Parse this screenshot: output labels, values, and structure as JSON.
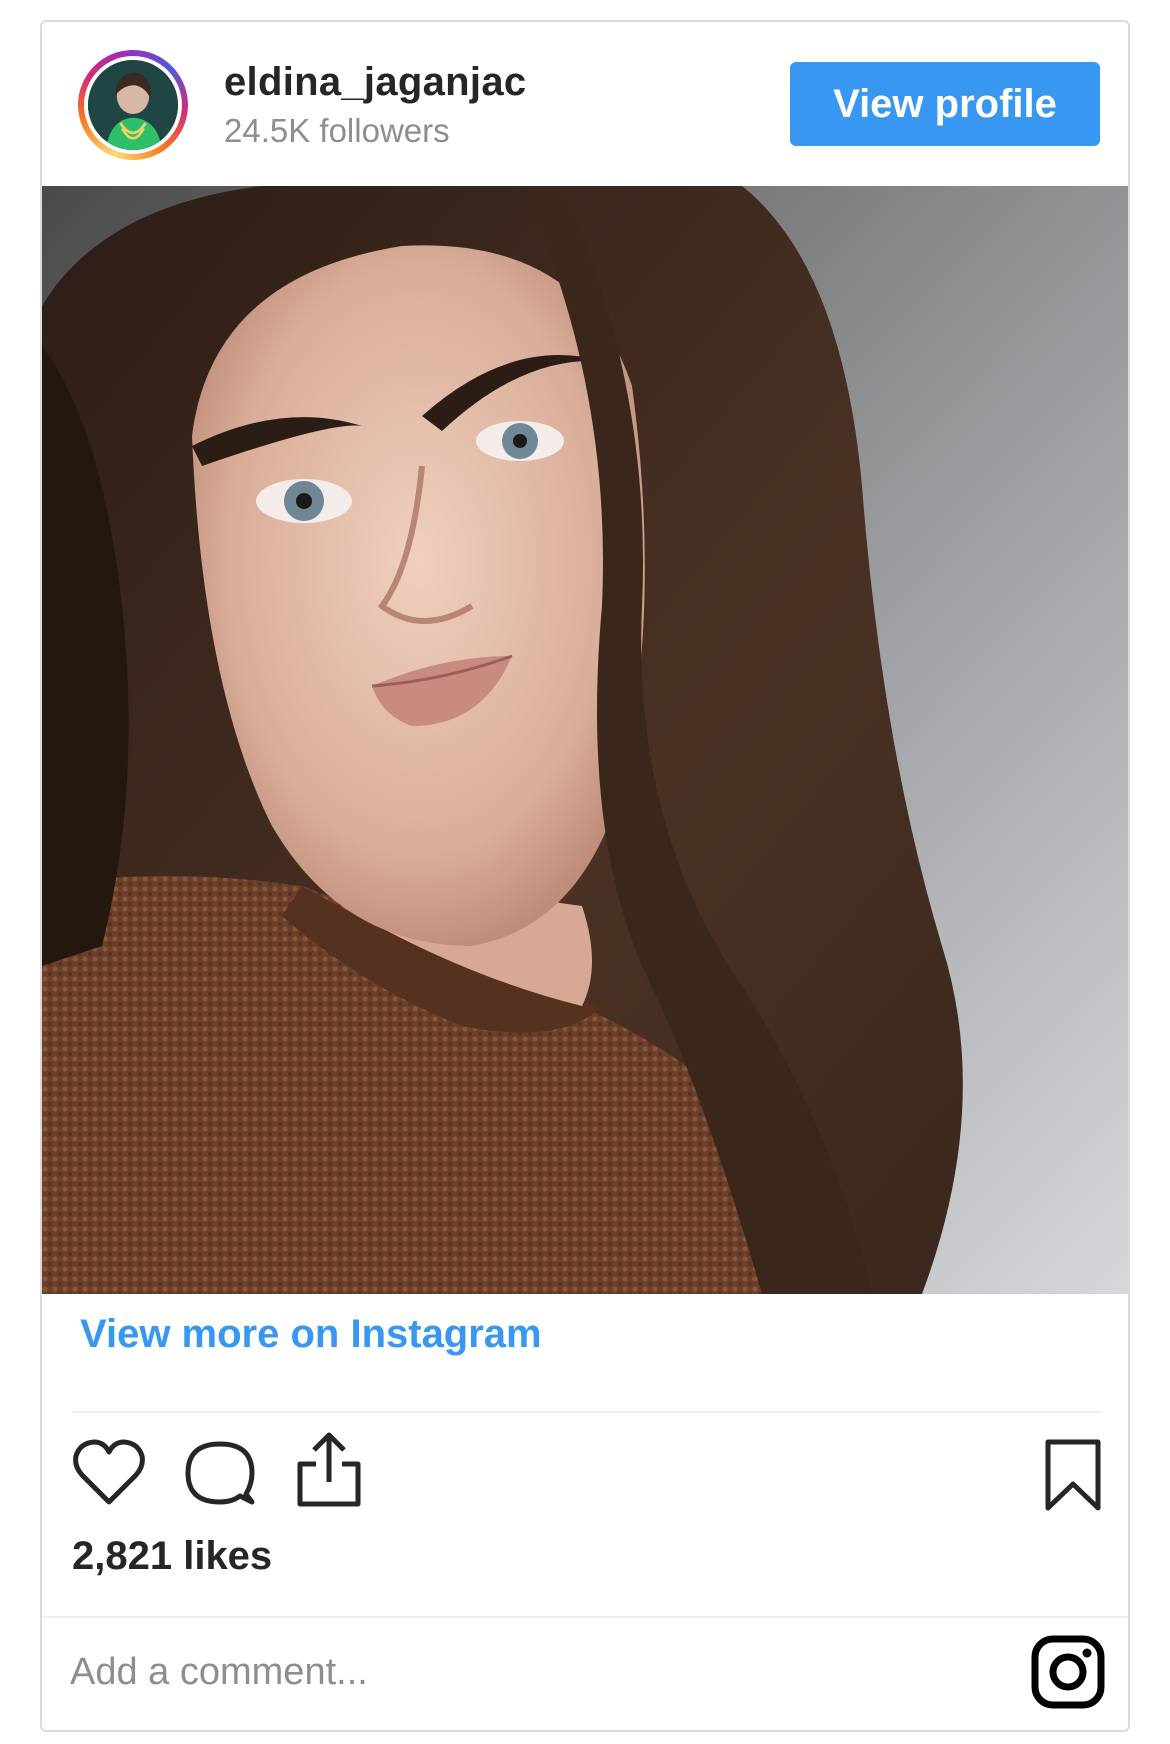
{
  "header": {
    "username": "eldina_jaganjac",
    "followers": "24.5K followers",
    "view_profile_label": "View profile"
  },
  "post": {
    "view_more_label": "View more on Instagram",
    "likes": "2,821 likes",
    "comment_placeholder": "Add a comment..."
  },
  "icons": {
    "like": "heart-icon",
    "comment": "comment-icon",
    "share": "share-icon",
    "save": "bookmark-icon",
    "brand": "instagram-icon"
  },
  "colors": {
    "accent": "#3897f0",
    "text": "#262626",
    "muted": "#8e8e8e",
    "border": "#dbdbdb"
  }
}
